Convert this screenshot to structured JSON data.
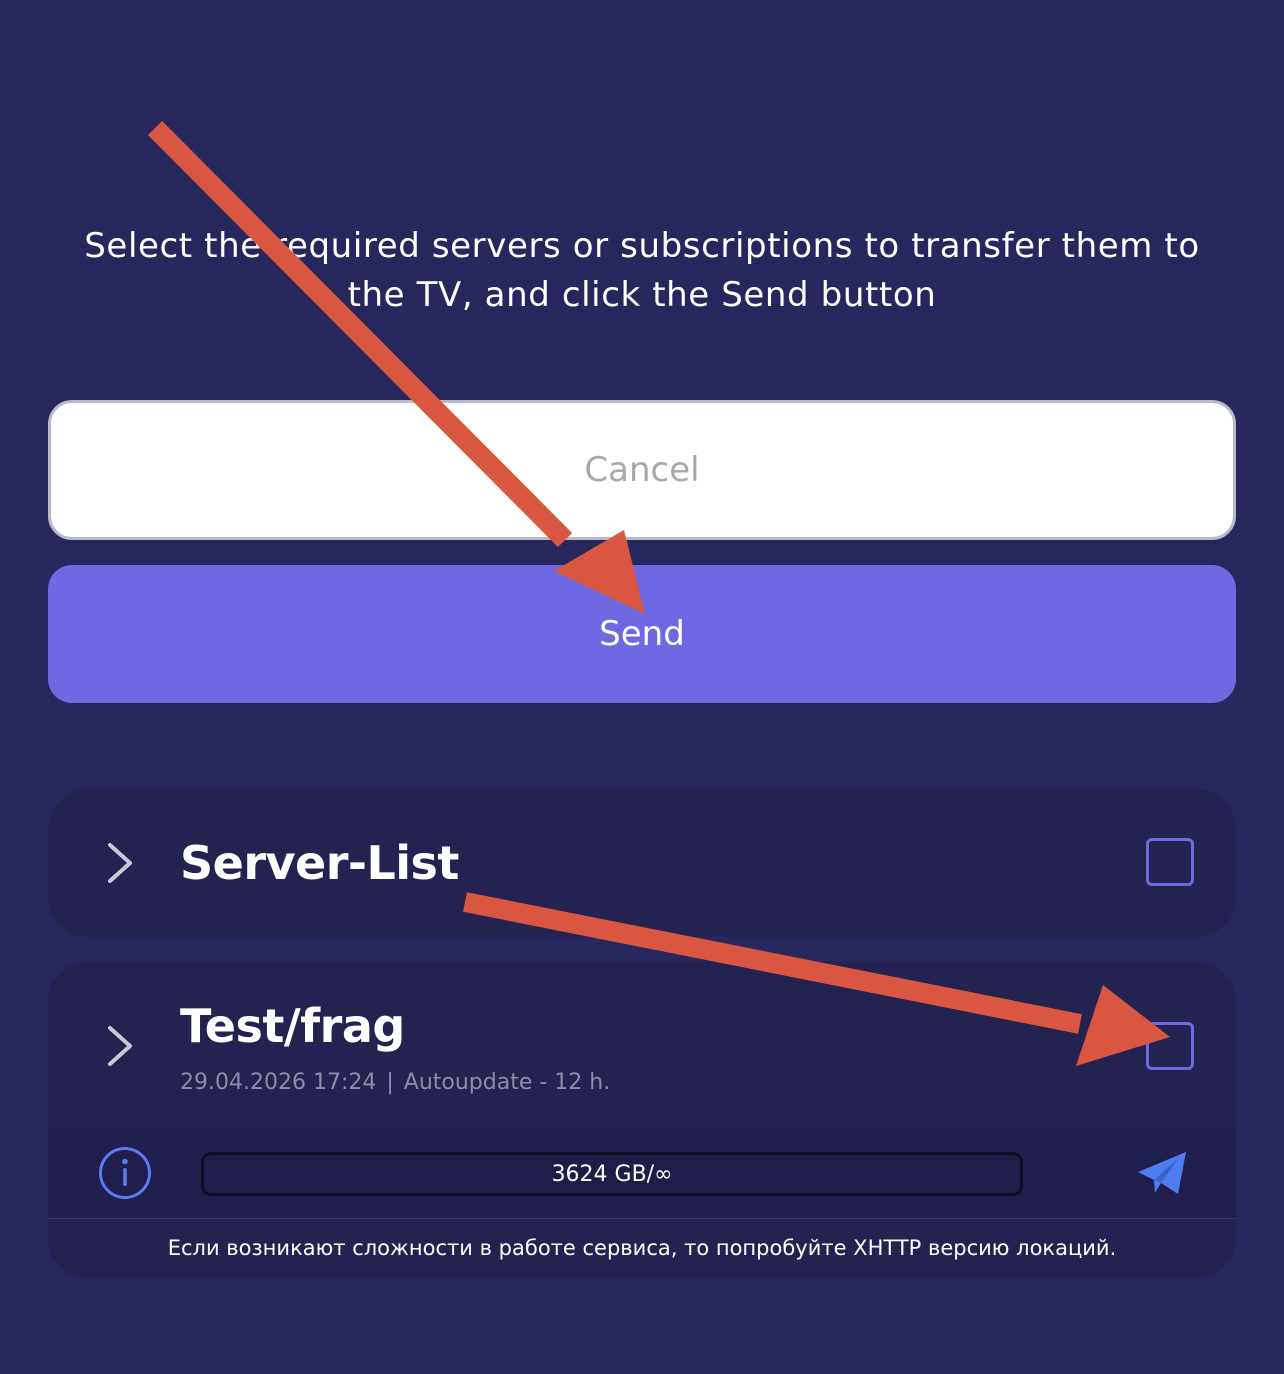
{
  "instruction": "Select the required servers or subscriptions to transfer them to the TV, and click the Send button",
  "buttons": {
    "cancel_label": "Cancel",
    "send_label": "Send"
  },
  "subscriptions": [
    {
      "title": "Server-List",
      "checked": false
    },
    {
      "title": "Test/frag",
      "checked": false,
      "updated": "29.04.2026 17:24",
      "separator": "|",
      "autoupdate": "Autoupdate - 12 h."
    }
  ],
  "traffic": {
    "label": "3624 GB/∞"
  },
  "notice": "Если возникают сложности в работе сервиса, то попробуйте XHTTP версию локаций.",
  "icons": {
    "expand": "chevron-right-icon",
    "info": "info-icon",
    "share": "telegram-icon"
  },
  "colors": {
    "background": "#28275d",
    "card": "#232250",
    "accent": "#6e69e3",
    "annotation_arrow": "#d95640"
  }
}
